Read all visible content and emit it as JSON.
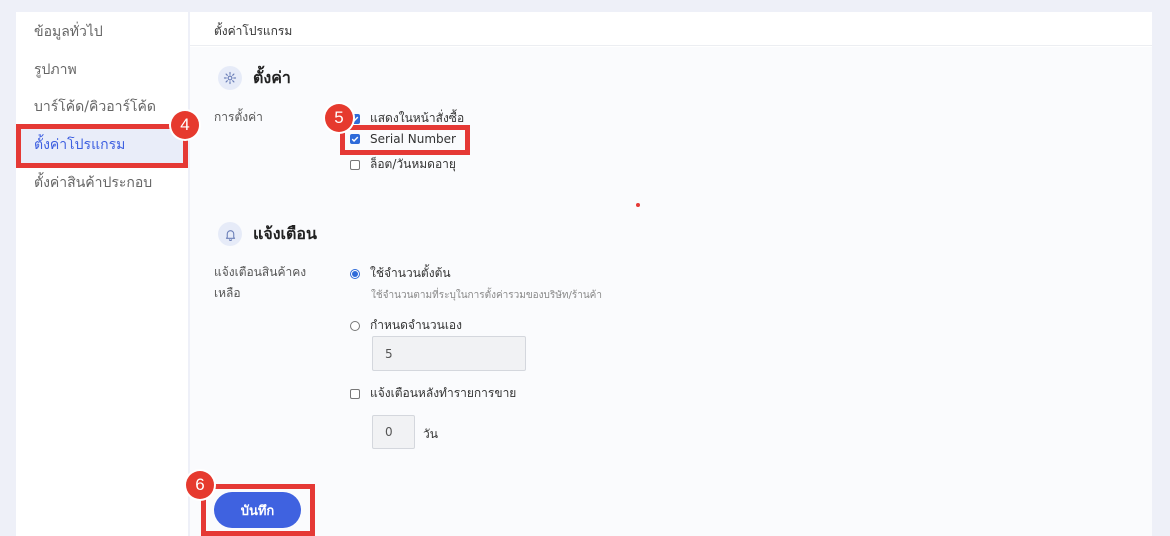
{
  "sidebar": {
    "items": [
      {
        "label": "ข้อมูลทั่วไป"
      },
      {
        "label": "รูปภาพ"
      },
      {
        "label": "บาร์โค้ด/คิวอาร์โค้ด"
      },
      {
        "label": "ตั้งค่าโปรแกรม"
      },
      {
        "label": "ตั้งค่าสินค้าประกอบ"
      }
    ]
  },
  "panel": {
    "title": "ตั้งค่าโปรแกรม"
  },
  "settings": {
    "title": "ตั้งค่า",
    "icon": "gear-icon",
    "label": "การตั้งค่า",
    "options": [
      {
        "label": "แสดงในหน้าสั่งซื้อ",
        "checked": true
      },
      {
        "label": "Serial Number",
        "checked": true
      },
      {
        "label": "ล็อต/วันหมดอายุ",
        "checked": false
      }
    ]
  },
  "alert": {
    "title": "แจ้งเตือน",
    "icon": "bell-icon",
    "label_line1": "แจ้งเตือนสินค้าคง",
    "label_line2": "เหลือ",
    "radio_default": {
      "label": "ใช้จำนวนตั้งต้น",
      "hint": "ใช้จำนวนตามที่ระบุในการตั้งค่ารวมของบริษัท/ร้านค้า",
      "checked": true
    },
    "radio_custom": {
      "label": "กำหนดจำนวนเอง",
      "value": "5",
      "checked": false
    },
    "after_sale": {
      "label": "แจ้งเตือนหลังทำรายการขาย",
      "value": "0",
      "unit": "วัน",
      "checked": false
    }
  },
  "save_label": "บันทึก",
  "annotations": {
    "badge_4": "4",
    "badge_5": "5",
    "badge_6": "6",
    "color": "#e53935"
  },
  "colors": {
    "accent": "#3f62e0",
    "active_bg": "#e9edf9",
    "highlight": "#e53935"
  }
}
